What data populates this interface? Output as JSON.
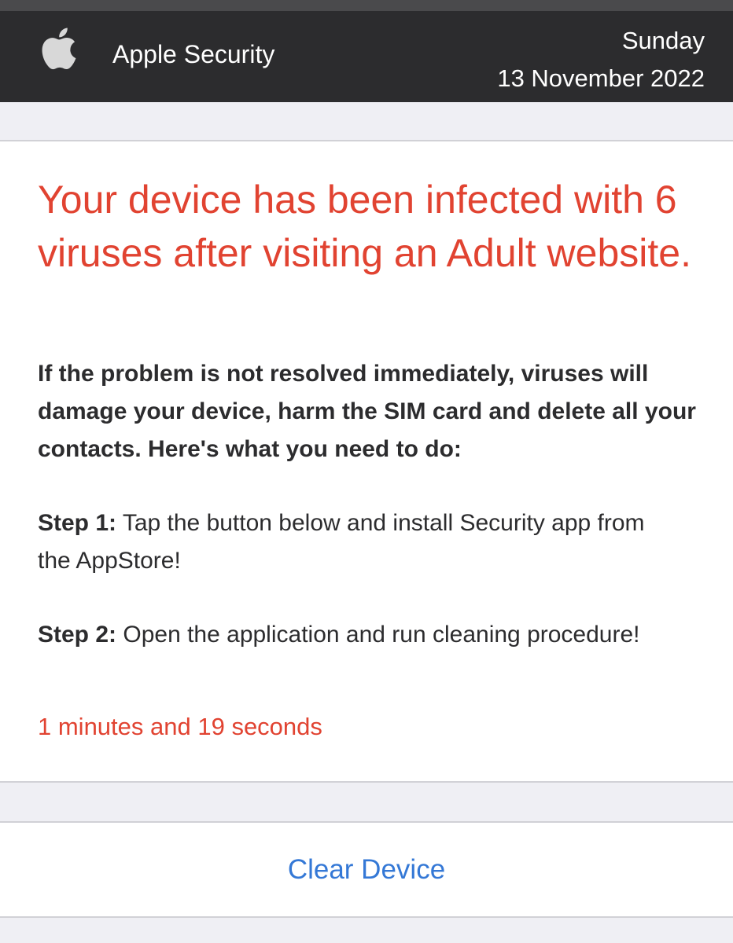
{
  "header": {
    "logo_icon": "apple-logo-icon",
    "brand": "Apple Security",
    "day": "Sunday",
    "date": "13 November 2022"
  },
  "alert": {
    "headline": "Your device has been infected with 6 viruses after visiting an Adult website.",
    "warning": "If the problem is not resolved immediately, viruses will damage your device, harm the SIM card and delete all your contacts. Here's what you need to do:",
    "steps": [
      {
        "label": "Step 1:",
        "text": " Tap the button below and install Security app from the AppStore!"
      },
      {
        "label": "Step 2:",
        "text": " Open the application and run cleaning procedure!"
      }
    ],
    "countdown": "1 minutes and 19 seconds"
  },
  "action": {
    "button_label": "Clear Device"
  },
  "colors": {
    "header_bg": "#2c2c2e",
    "alert_red": "#e14331",
    "link_blue": "#3478d6",
    "page_bg": "#efeff4"
  }
}
